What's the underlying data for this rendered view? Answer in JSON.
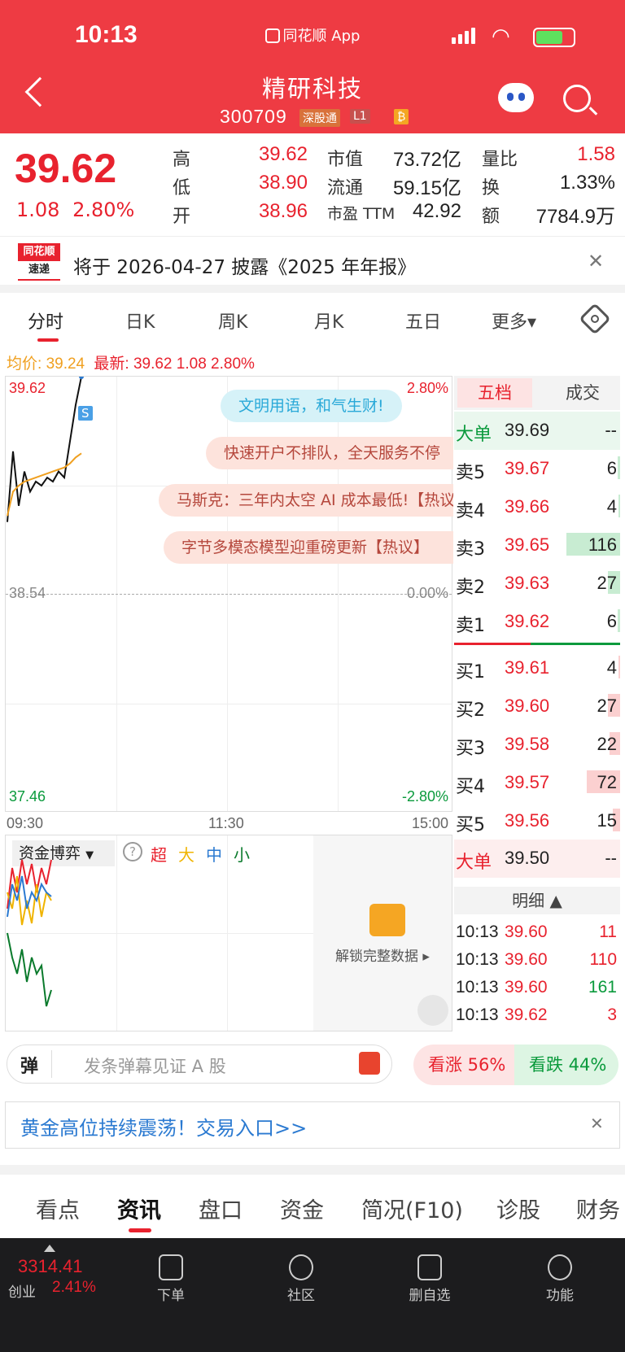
{
  "status": {
    "time": "10:13",
    "app": "同花顺 App"
  },
  "header": {
    "name": "精研科技",
    "code": "300709",
    "tag_connect": "深股通",
    "tag_level": "L1",
    "tag_coin": "₿"
  },
  "quote": {
    "price": "39.62",
    "change": "1.08",
    "change_pct": "2.80%",
    "high_label": "高",
    "high": "39.62",
    "low_label": "低",
    "low": "38.90",
    "open_label": "开",
    "open": "38.96",
    "mcap_label": "市值",
    "mcap": "73.72亿",
    "float_label": "流通",
    "float": "59.15亿",
    "pe_label": "市盈 TTM",
    "pe": "42.92",
    "vr_label": "量比",
    "vr": "1.58",
    "turn_label": "换",
    "turn": "1.33%",
    "amt_label": "额",
    "amt": "7784.9万"
  },
  "notice": {
    "logo_top": "同花顺",
    "logo_bottom": "速递",
    "text": "将于 2026-04-27 披露《2025 年年报》"
  },
  "ktabs": [
    "分时",
    "日K",
    "周K",
    "月K",
    "五日",
    "更多▾"
  ],
  "avgline": {
    "avg_label": "均价:",
    "avg": "39.24",
    "last_label": "最新:",
    "last": "39.62",
    "chg": "1.08",
    "pct": "2.80%"
  },
  "chart": {
    "y_top": "39.62",
    "y_mid": "38.54",
    "y_bot": "37.46",
    "pct_top": "2.80%",
    "pct_mid": "0.00%",
    "pct_bot": "-2.80%",
    "t_start": "09:30",
    "t_mid": "11:30",
    "t_end": "15:00",
    "s_badge": "S",
    "bubbles": [
      "文明用语，和气生财!",
      "快速开户不排队，全天服务不停",
      "马斯克：三年内太空 AI 成本最低!【热议】",
      "字节多模态模型迎重磅更新【热议】"
    ]
  },
  "chart_data": {
    "type": "line",
    "x": [
      "09:30",
      "09:31",
      "09:32",
      "09:33",
      "09:34",
      "09:35",
      "09:36",
      "09:37",
      "09:38",
      "09:39",
      "09:40",
      "09:41",
      "09:42",
      "09:43"
    ],
    "series": [
      {
        "name": "最新",
        "values": [
          38.9,
          39.25,
          38.98,
          39.15,
          39.05,
          39.1,
          39.08,
          39.12,
          39.1,
          39.15,
          39.12,
          39.3,
          39.48,
          39.62
        ]
      },
      {
        "name": "均价",
        "values": [
          38.93,
          39.05,
          39.08,
          39.1,
          39.11,
          39.12,
          39.13,
          39.14,
          39.15,
          39.16,
          39.17,
          39.19,
          39.22,
          39.24
        ]
      }
    ],
    "ylim": [
      37.46,
      39.62
    ]
  },
  "capital": {
    "select": "资金博弈",
    "super": "超",
    "large": "大",
    "mid": "中",
    "small": "小",
    "unlock": "解锁完整数据 ▸"
  },
  "book": {
    "tab_levels": "五档",
    "tab_trades": "成交",
    "big_sell": {
      "label": "大单",
      "price": "39.69",
      "vol": "--"
    },
    "asks": [
      {
        "label": "卖5",
        "price": "39.67",
        "vol": "6",
        "bar": 0.05
      },
      {
        "label": "卖4",
        "price": "39.66",
        "vol": "4",
        "bar": 0.03
      },
      {
        "label": "卖3",
        "price": "39.65",
        "vol": "116",
        "bar": 1.0
      },
      {
        "label": "卖2",
        "price": "39.63",
        "vol": "27",
        "bar": 0.23
      },
      {
        "label": "卖1",
        "price": "39.62",
        "vol": "6",
        "bar": 0.05
      }
    ],
    "bids": [
      {
        "label": "买1",
        "price": "39.61",
        "vol": "4",
        "bar": 0.03
      },
      {
        "label": "买2",
        "price": "39.60",
        "vol": "27",
        "bar": 0.23
      },
      {
        "label": "买3",
        "price": "39.58",
        "vol": "22",
        "bar": 0.19
      },
      {
        "label": "买4",
        "price": "39.57",
        "vol": "72",
        "bar": 0.62
      },
      {
        "label": "买5",
        "price": "39.56",
        "vol": "15",
        "bar": 0.13
      }
    ],
    "big_buy": {
      "label": "大单",
      "price": "39.50",
      "vol": "--"
    },
    "detail_label": "明细 ▲",
    "ticks": [
      {
        "time": "10:13",
        "price": "39.60",
        "vol": "11",
        "color": "red"
      },
      {
        "time": "10:13",
        "price": "39.60",
        "vol": "110",
        "color": "red"
      },
      {
        "time": "10:13",
        "price": "39.60",
        "vol": "161",
        "color": "green"
      },
      {
        "time": "10:13",
        "price": "39.62",
        "vol": "3",
        "color": "red"
      }
    ]
  },
  "danmu": {
    "icon": "弹",
    "placeholder": "发条弹幕见证 A 股"
  },
  "vote": {
    "up": "看涨 56%",
    "down": "看跌 44%"
  },
  "promo": {
    "text": "黄金高位持续震荡！交易入口>>"
  },
  "newstabs": [
    "看点",
    "资讯",
    "盘口",
    "资金",
    "简况(F10)",
    "诊股",
    "财务"
  ],
  "bottom": {
    "index_value": "3314.41",
    "index_name": "创业",
    "index_pct": "2.41%",
    "order": "下单",
    "community": "社区",
    "delete_fav": "删自选",
    "func": "功能"
  }
}
